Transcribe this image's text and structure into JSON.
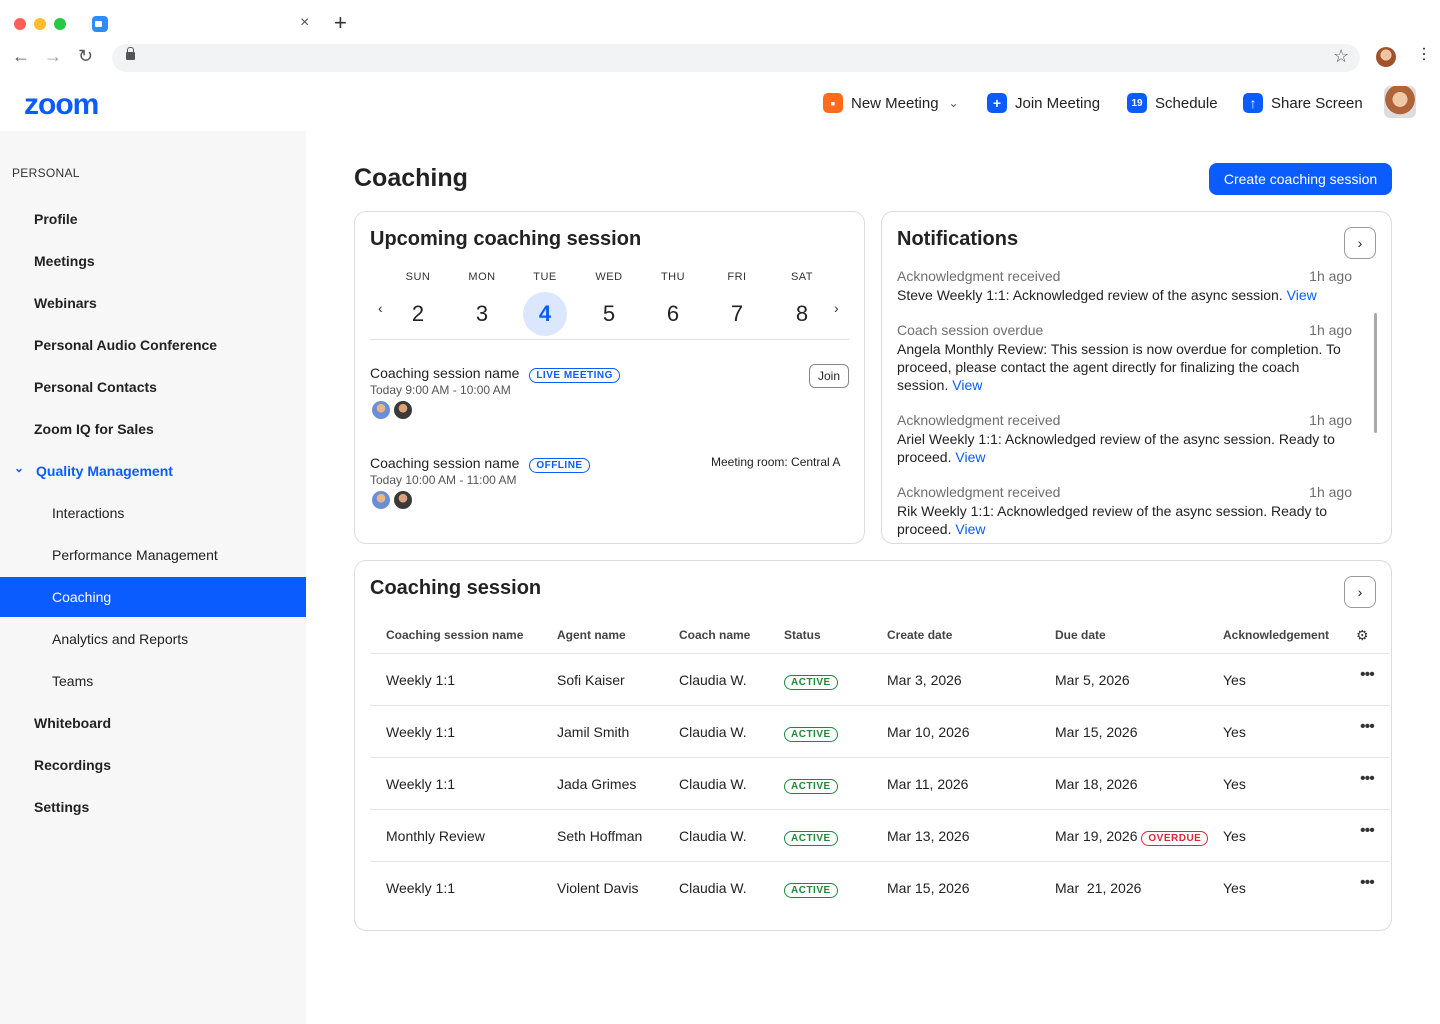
{
  "browser": {
    "tab_close": "×",
    "tab_new": "+",
    "back": "←",
    "forward": "→",
    "reload": "↻",
    "star": "☆",
    "menu": "⋯"
  },
  "app": {
    "logo": "zoom"
  },
  "topnav": {
    "new_meeting": "New Meeting",
    "new_meeting_caret": "⌄",
    "join_meeting": "Join Meeting",
    "schedule": "Schedule",
    "schedule_day": "19",
    "share_screen": "Share Screen"
  },
  "sidebar": {
    "section": "PERSONAL",
    "items": [
      {
        "label": "Profile"
      },
      {
        "label": "Meetings"
      },
      {
        "label": "Webinars"
      },
      {
        "label": "Personal Audio Conference"
      },
      {
        "label": "Personal Contacts"
      },
      {
        "label": "Zoom IQ for Sales"
      },
      {
        "label": "Quality Management"
      },
      {
        "label": "Interactions"
      },
      {
        "label": "Performance Management"
      },
      {
        "label": "Coaching"
      },
      {
        "label": "Analytics and Reports"
      },
      {
        "label": "Teams"
      },
      {
        "label": "Whiteboard"
      },
      {
        "label": "Recordings"
      },
      {
        "label": "Settings"
      }
    ]
  },
  "page": {
    "title": "Coaching",
    "create_button": "Create coaching session"
  },
  "upcoming": {
    "title": "Upcoming coaching session",
    "days": [
      {
        "name": "SUN",
        "num": "2"
      },
      {
        "name": "MON",
        "num": "3"
      },
      {
        "name": "TUE",
        "num": "4"
      },
      {
        "name": "WED",
        "num": "5"
      },
      {
        "name": "THU",
        "num": "6"
      },
      {
        "name": "FRI",
        "num": "7"
      },
      {
        "name": "SAT",
        "num": "8"
      }
    ],
    "prev": "‹",
    "next": "›",
    "sessions": [
      {
        "name": "Coaching session name",
        "badge": "LIVE MEETING",
        "time": "Today 9:00 AM - 10:00 AM",
        "action": "Join"
      },
      {
        "name": "Coaching session name",
        "badge": "OFFLINE",
        "time": "Today 10:00 AM - 11:00 AM",
        "location": "Meeting room: Central A"
      }
    ]
  },
  "notifications": {
    "title": "Notifications",
    "arrow": "›",
    "items": [
      {
        "type": "Acknowledgment received",
        "time": "1h ago",
        "body": "Steve Weekly 1:1: Acknowledged review of the async session.",
        "link": "View"
      },
      {
        "type": "Coach session overdue",
        "time": "1h ago",
        "body": "Angela Monthly Review: This session is now overdue for completion. To proceed, please contact the agent directly for finalizing the coach session.",
        "link": "View"
      },
      {
        "type": "Acknowledgment received",
        "time": "1h ago",
        "body": "Ariel Weekly 1:1: Acknowledged review of the async session. Ready to proceed.",
        "link": "View"
      },
      {
        "type": "Acknowledgment received",
        "time": "1h ago",
        "body": "Rik Weekly 1:1: Acknowledged review of the async session. Ready to proceed.",
        "link": "View"
      }
    ]
  },
  "table": {
    "title": "Coaching session",
    "arrow": "›",
    "gear": "⚙",
    "more": "•••",
    "headers": [
      "Coaching session name",
      "Agent name",
      "Coach name",
      "Status",
      "Create date",
      "Due date",
      "Acknowledgement"
    ],
    "rows": [
      {
        "name": "Weekly 1:1",
        "agent": "Sofi Kaiser",
        "coach": "Claudia W.",
        "status": "ACTIVE",
        "created": "Mar 3, 2026",
        "due": "Mar 5, 2026",
        "overdue": "",
        "ack": "Yes"
      },
      {
        "name": "Weekly 1:1",
        "agent": "Jamil Smith",
        "coach": "Claudia W.",
        "status": "ACTIVE",
        "created": "Mar 10, 2026",
        "due": "Mar 15, 2026",
        "overdue": "",
        "ack": "Yes"
      },
      {
        "name": "Weekly 1:1",
        "agent": "Jada Grimes",
        "coach": "Claudia W.",
        "status": "ACTIVE",
        "created": "Mar 11, 2026",
        "due": "Mar 18, 2026",
        "overdue": "",
        "ack": "Yes"
      },
      {
        "name": "Monthly Review",
        "agent": "Seth Hoffman",
        "coach": "Claudia W.",
        "status": "ACTIVE",
        "created": "Mar 13, 2026",
        "due": "Mar 19, 2026",
        "overdue": "OVERDUE",
        "ack": "Yes"
      },
      {
        "name": "Weekly 1:1",
        "agent": "Violent Davis",
        "coach": "Claudia W.",
        "status": "ACTIVE",
        "created": "Mar 15, 2026",
        "due": "Mar  21, 2026",
        "overdue": "",
        "ack": "Yes"
      }
    ]
  },
  "colors": {
    "accent": "#0B5CFF",
    "active_green": "#1b8a3a",
    "overdue_red": "#d42a3a",
    "new_meeting_orange": "#FF6B1A"
  }
}
